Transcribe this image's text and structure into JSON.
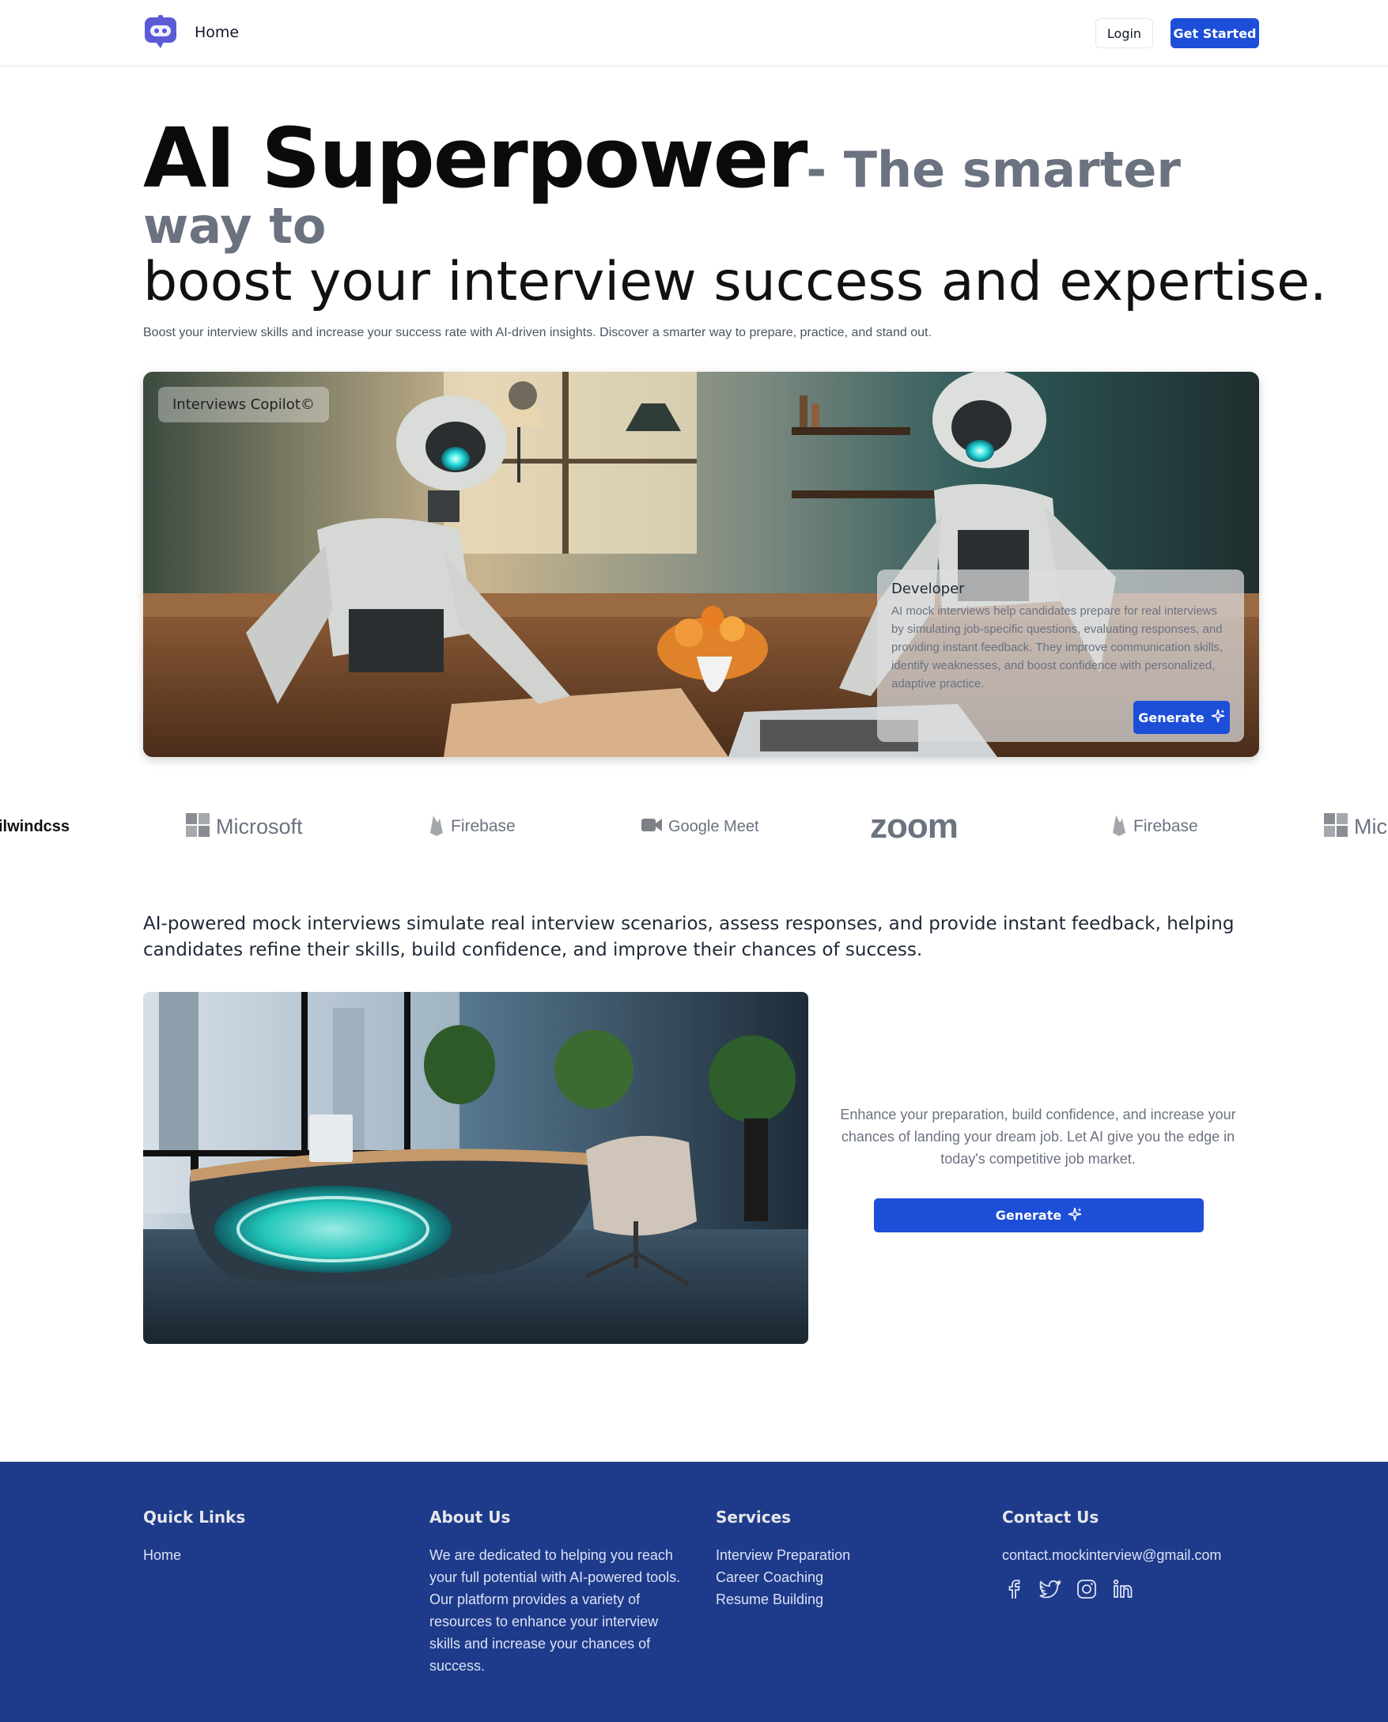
{
  "header": {
    "home_label": "Home",
    "login_label": "Login",
    "get_started_label": "Get Started",
    "accent_color": "#1d4ed8"
  },
  "hero": {
    "title_big": "AI Superpower",
    "title_grey_a": "- The smarter",
    "title_grey_b": "way to",
    "title_line3": "boost your interview success and expertise.",
    "subtitle": "Boost your interview skills and increase your success rate with AI-driven insights. Discover a smarter way to prepare, practice, and stand out.",
    "image_icon": "robots-at-desk-image"
  },
  "hero_card": {
    "badge": "Interviews Copilot©",
    "title": "Developer",
    "text": "AI mock interviews help candidates prepare for real interviews by simulating job-specific questions, evaluating responses, and providing instant feedback. They improve communication skills, identify weaknesses, and boost confidence with personalized, adaptive practice.",
    "button_label": "Generate"
  },
  "logos": [
    {
      "name": "ilwindcss"
    },
    {
      "name": "Microsoft"
    },
    {
      "name": "Firebase"
    },
    {
      "name": "Google Meet"
    },
    {
      "name": "zoom"
    },
    {
      "name": "Firebase"
    },
    {
      "name": "Micr"
    }
  ],
  "mid": {
    "text": "AI-powered mock interviews simulate real interview scenarios, assess responses, and provide instant feedback, helping candidates refine their skills, build confidence, and improve their chances of success."
  },
  "feature": {
    "image_icon": "futuristic-office-desk-image",
    "text": "Enhance your preparation, build confidence, and increase your chances of landing your dream job. Let AI give you the edge in today's competitive job market.",
    "button_label": "Generate"
  },
  "footer": {
    "background": "#1e3a8a",
    "quick_links": {
      "heading": "Quick Links",
      "items": [
        "Home"
      ]
    },
    "about": {
      "heading": "About Us",
      "text": "We are dedicated to helping you reach your full potential with AI-powered tools. Our platform provides a variety of resources to enhance your interview skills and increase your chances of success."
    },
    "services": {
      "heading": "Services",
      "items": [
        "Interview Preparation",
        "Career Coaching",
        "Resume Building"
      ]
    },
    "contact": {
      "heading": "Contact Us",
      "email": "contact.mockinterview@gmail.com",
      "social_icons": [
        "facebook-icon",
        "twitter-icon",
        "instagram-icon",
        "linkedin-icon"
      ]
    }
  }
}
